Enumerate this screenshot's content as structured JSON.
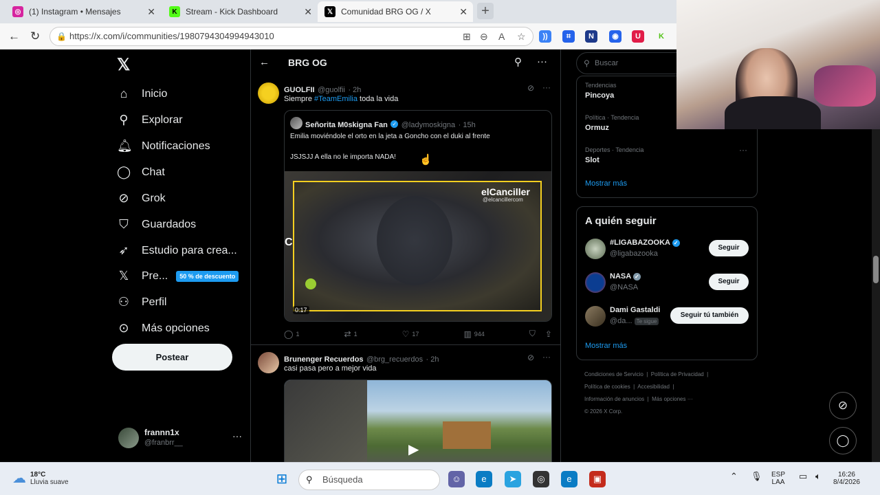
{
  "browser": {
    "tabs": [
      {
        "title": "(1) Instagram • Mensajes",
        "icon": "instagram-icon",
        "color": "#d6249f"
      },
      {
        "title": "Stream - Kick Dashboard",
        "icon": "kick-icon",
        "color": "#53fc18"
      },
      {
        "title": "Comunidad BRG OG / X",
        "icon": "x-icon",
        "color": "#000000"
      }
    ],
    "url": "https://x.com/i/communities/1980794304994943010"
  },
  "sidebar": {
    "items": [
      {
        "label": "Inicio",
        "icon": "home-icon"
      },
      {
        "label": "Explorar",
        "icon": "search-icon"
      },
      {
        "label": "Notificaciones",
        "icon": "bell-icon"
      },
      {
        "label": "Chat",
        "icon": "chat-icon"
      },
      {
        "label": "Grok",
        "icon": "grok-icon"
      },
      {
        "label": "Guardados",
        "icon": "bookmark-icon"
      },
      {
        "label": "Estudio para crea...",
        "icon": "rocket-icon"
      },
      {
        "label": "Pre...",
        "icon": "x-premium-icon",
        "badge": "50 % de descuento"
      },
      {
        "label": "Perfil",
        "icon": "person-icon"
      },
      {
        "label": "Más opciones",
        "icon": "more-circle-icon"
      }
    ],
    "post_button": "Postear",
    "account": {
      "name": "frannn1x",
      "handle": "@franbrr__"
    }
  },
  "feed": {
    "title": "BRG OG",
    "tweets": [
      {
        "name": "GUOLFII",
        "handle": "@guolfii",
        "time": "· 2h",
        "text_before": "Siempre ",
        "hashtag": "#TeamEmilia",
        "text_after": " toda la vida",
        "quote": {
          "name": "Señorita M0skigna Fan",
          "handle": "@ladymoskigna",
          "time": "· 15h",
          "line1": "Emilia moviéndole el orto en la jeta a Goncho con el duki al frente",
          "line2": "JSJSJJ A ella no le importa NADA!",
          "video_watermark": "elCanciller",
          "video_watermark_handle": "@elcancillercom",
          "video_duration": "0:17"
        },
        "replies": "1",
        "reposts": "1",
        "likes": "17",
        "views": "944"
      },
      {
        "name": "Brunenger Recuerdos",
        "handle": "@brg_recuerdos",
        "time": "· 2h",
        "text": "casi pasa pero a mejor vida"
      }
    ]
  },
  "right": {
    "search_placeholder": "Buscar",
    "trends": [
      {
        "context": "Tendencias",
        "name": "Pincoya"
      },
      {
        "context": "Política · Tendencia",
        "name": "Ormuz"
      },
      {
        "context": "Deportes · Tendencia",
        "name": "Slot"
      }
    ],
    "show_more": "Mostrar más",
    "who_to_follow_title": "A quién seguir",
    "who_to_follow": [
      {
        "name": "#LIGABAZOOKA",
        "handle": "@ligabazooka",
        "button": "Seguir",
        "verified": "blue"
      },
      {
        "name": "NASA",
        "handle": "@NASA",
        "button": "Seguir",
        "verified": "gray"
      },
      {
        "name": "Dami Gastaldi",
        "handle": "@da...",
        "button": "Seguir tú también",
        "follows_you": "Te sigue"
      }
    ],
    "footer": [
      "Condiciones de Servicio",
      "Política de Privacidad",
      "Política de cookies",
      "Accesibilidad",
      "Información de anuncios",
      "Más opciones ···",
      "© 2026 X Corp."
    ]
  },
  "taskbar": {
    "temp": "18°C",
    "weather": "Lluvia suave",
    "search": "Búsqueda",
    "lang1": "ESP",
    "lang2": "LAA",
    "time": "16:26",
    "date": "8/4/2026"
  }
}
